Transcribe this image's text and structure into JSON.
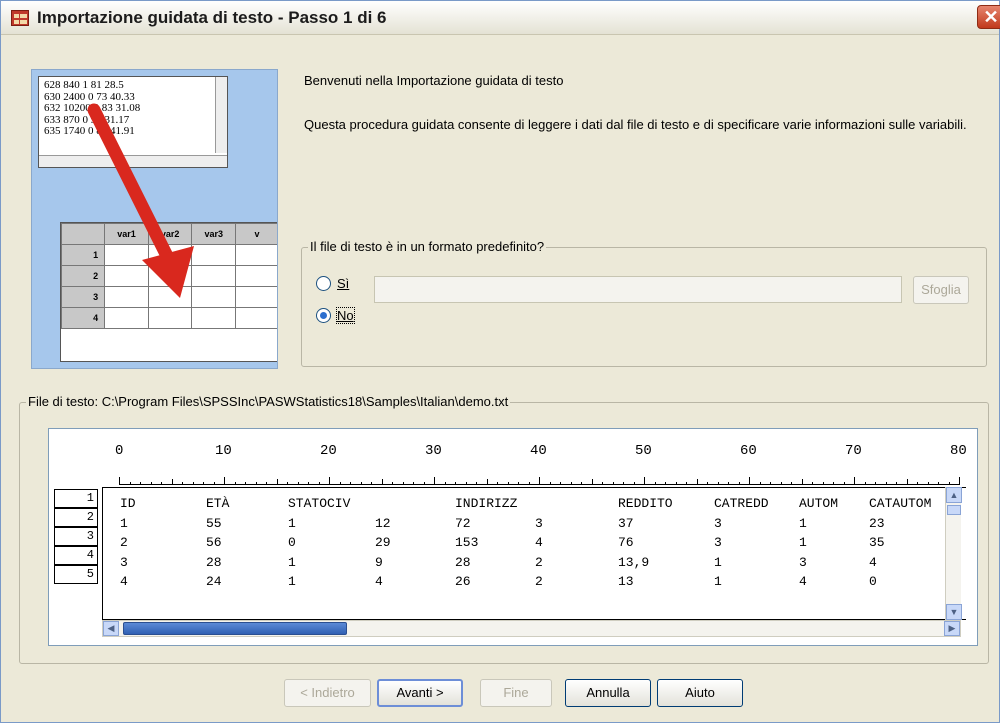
{
  "window": {
    "title": "Importazione guidata di testo - Passo 1 di 6",
    "close_glyph": "✕"
  },
  "illustration": {
    "text_lines": [
      "628 840 1 81 28.5",
      "630 2400 0 73 40.33",
      "632 10200 0 83 31.08",
      "633 870 0 93 31.17",
      "635 1740 0 83 41.91"
    ],
    "var_headers": [
      "var1",
      "var2",
      "var3",
      "v"
    ],
    "row_numbers": [
      "1",
      "2",
      "3",
      "4"
    ]
  },
  "welcome": "Benvenuti nella Importazione guidata di testo",
  "description": "Questa procedura guidata consente di leggere i dati dal file di testo e di specificare varie informazioni sulle variabili.",
  "format_group": {
    "legend": "Il file di testo è in un formato predefinito?",
    "option_yes": "Sì",
    "option_no": "No",
    "selected": "No",
    "path_value": "",
    "browse_label": "Sfoglia"
  },
  "file_group": {
    "legend": "File di testo: C:\\Program Files\\SPSSInc\\PASWStatistics18\\Samples\\Italian\\demo.txt",
    "ruler_numbers": [
      "0",
      "10",
      "20",
      "30",
      "40",
      "50",
      "60",
      "70",
      "80"
    ],
    "row_numbers": [
      "1",
      "2",
      "3",
      "4",
      "5"
    ],
    "lines": [
      [
        "ID",
        "ETÀ",
        "STATOCIV",
        "",
        "INDIRIZZ",
        "",
        "REDDITO",
        "CATREDD",
        "AUTOM",
        "CATAUTOM"
      ],
      [
        "1",
        "55",
        "1",
        "12",
        "72",
        "3",
        "37",
        "3",
        "1",
        "23"
      ],
      [
        "2",
        "56",
        "0",
        "29",
        "153",
        "4",
        "76",
        "3",
        "1",
        "35"
      ],
      [
        "3",
        "28",
        "1",
        "9",
        "28",
        "2",
        "13,9",
        "1",
        "3",
        "4"
      ],
      [
        "4",
        "24",
        "1",
        "4",
        "26",
        "2",
        "13",
        "1",
        "4",
        "0"
      ]
    ]
  },
  "buttons": {
    "back": "< Indietro",
    "next": "Avanti >",
    "finish": "Fine",
    "cancel": "Annulla",
    "help": "Aiuto"
  }
}
